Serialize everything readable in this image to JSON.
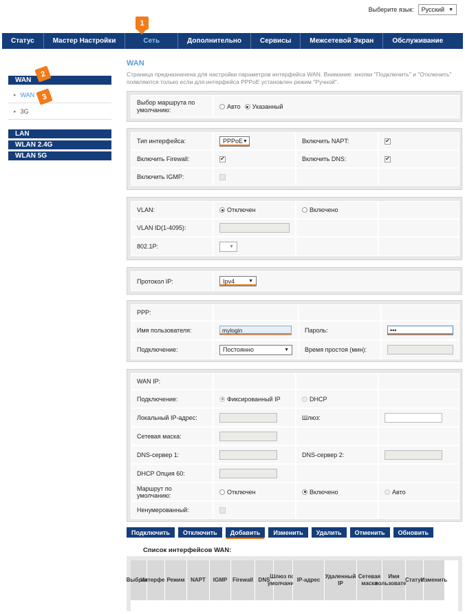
{
  "language": {
    "label": "Выберите язык:",
    "value": "Русский"
  },
  "nav": [
    "Статус",
    "Мастер Настройки",
    "Сеть",
    "Дополнительно",
    "Сервисы",
    "Межсетевой Экран",
    "Обслуживание"
  ],
  "nav_active": "Сеть",
  "badges": {
    "b1": "1",
    "b2": "2",
    "b3": "3"
  },
  "sidebar": {
    "wan_head": "WAN",
    "wan_sub": "WAN",
    "g3_sub": "3G",
    "lan": "LAN",
    "wlan24": "WLAN 2.4G",
    "wlan5": "WLAN 5G"
  },
  "page": {
    "title": "WAN",
    "description": "Страница предназначена для настройки параметров интерфейса WAN. Внимание: кнопки \"Подключить\" и \"Отключить\" появляются только если для интерфейса PPPoE установлен режим \"Ручной\"."
  },
  "route": {
    "label": "Выбор маршрута по умолчанию:",
    "auto": "Авто",
    "specified": "Указанный"
  },
  "iface": {
    "type_label": "Тип интерфейса:",
    "type_value": "PPPoE",
    "napt_label": "Включить NAPT:",
    "firewall_label": "Включить Firewall:",
    "dns_label": "Включить DNS:",
    "igmp_label": "Включить IGMP:"
  },
  "vlan": {
    "label": "VLAN:",
    "off": "Отключен",
    "on": "Включено",
    "id_label": "VLAN ID(1-4095):",
    "p_label": "802.1P:"
  },
  "protocol": {
    "label": "Протокол IP:",
    "value": "Ipv4"
  },
  "ppp": {
    "head": "PPP:",
    "user_label": "Имя пользователя:",
    "user_value": "mylogin",
    "pass_label": "Пароль:",
    "pass_value": "•••",
    "conn_label": "Подключение:",
    "conn_value": "Постоянно",
    "idle_label": "Время простоя (мин):"
  },
  "wanip": {
    "head": "WAN IP:",
    "conn_label": "Подключение:",
    "fixed": "Фиксированный IP",
    "dhcp": "DHCP",
    "local_label": "Локальный IP-адрес:",
    "gw_label": "Шлюз:",
    "mask_label": "Сетевая маска:",
    "dns1_label": "DNS-сервер 1:",
    "dns2_label": "DNS-сервер 2:",
    "dhcp60_label": "DHCP Опция 60:",
    "route_label": "Маршрут по умолчанию:",
    "route_off": "Отключен",
    "route_on": "Включено",
    "route_auto": "Авто",
    "unnum_label": "Ненумерованный:"
  },
  "buttons": [
    "Подключить",
    "Отключить",
    "Добавить",
    "Изменить",
    "Удалить",
    "Отменить",
    "Обновить"
  ],
  "list_title": "Список интерфейсов WAN:",
  "table_headers": [
    "Выбрать",
    "Интерфейс",
    "Режим",
    "NAPT",
    "IGMP",
    "Firewall",
    "DNS",
    "Шлюз по-умолчанию",
    "IP-адрес",
    "Удаленный IP",
    "Сетевая маска",
    "Имя пользователя",
    "Статус",
    "Изменить"
  ]
}
